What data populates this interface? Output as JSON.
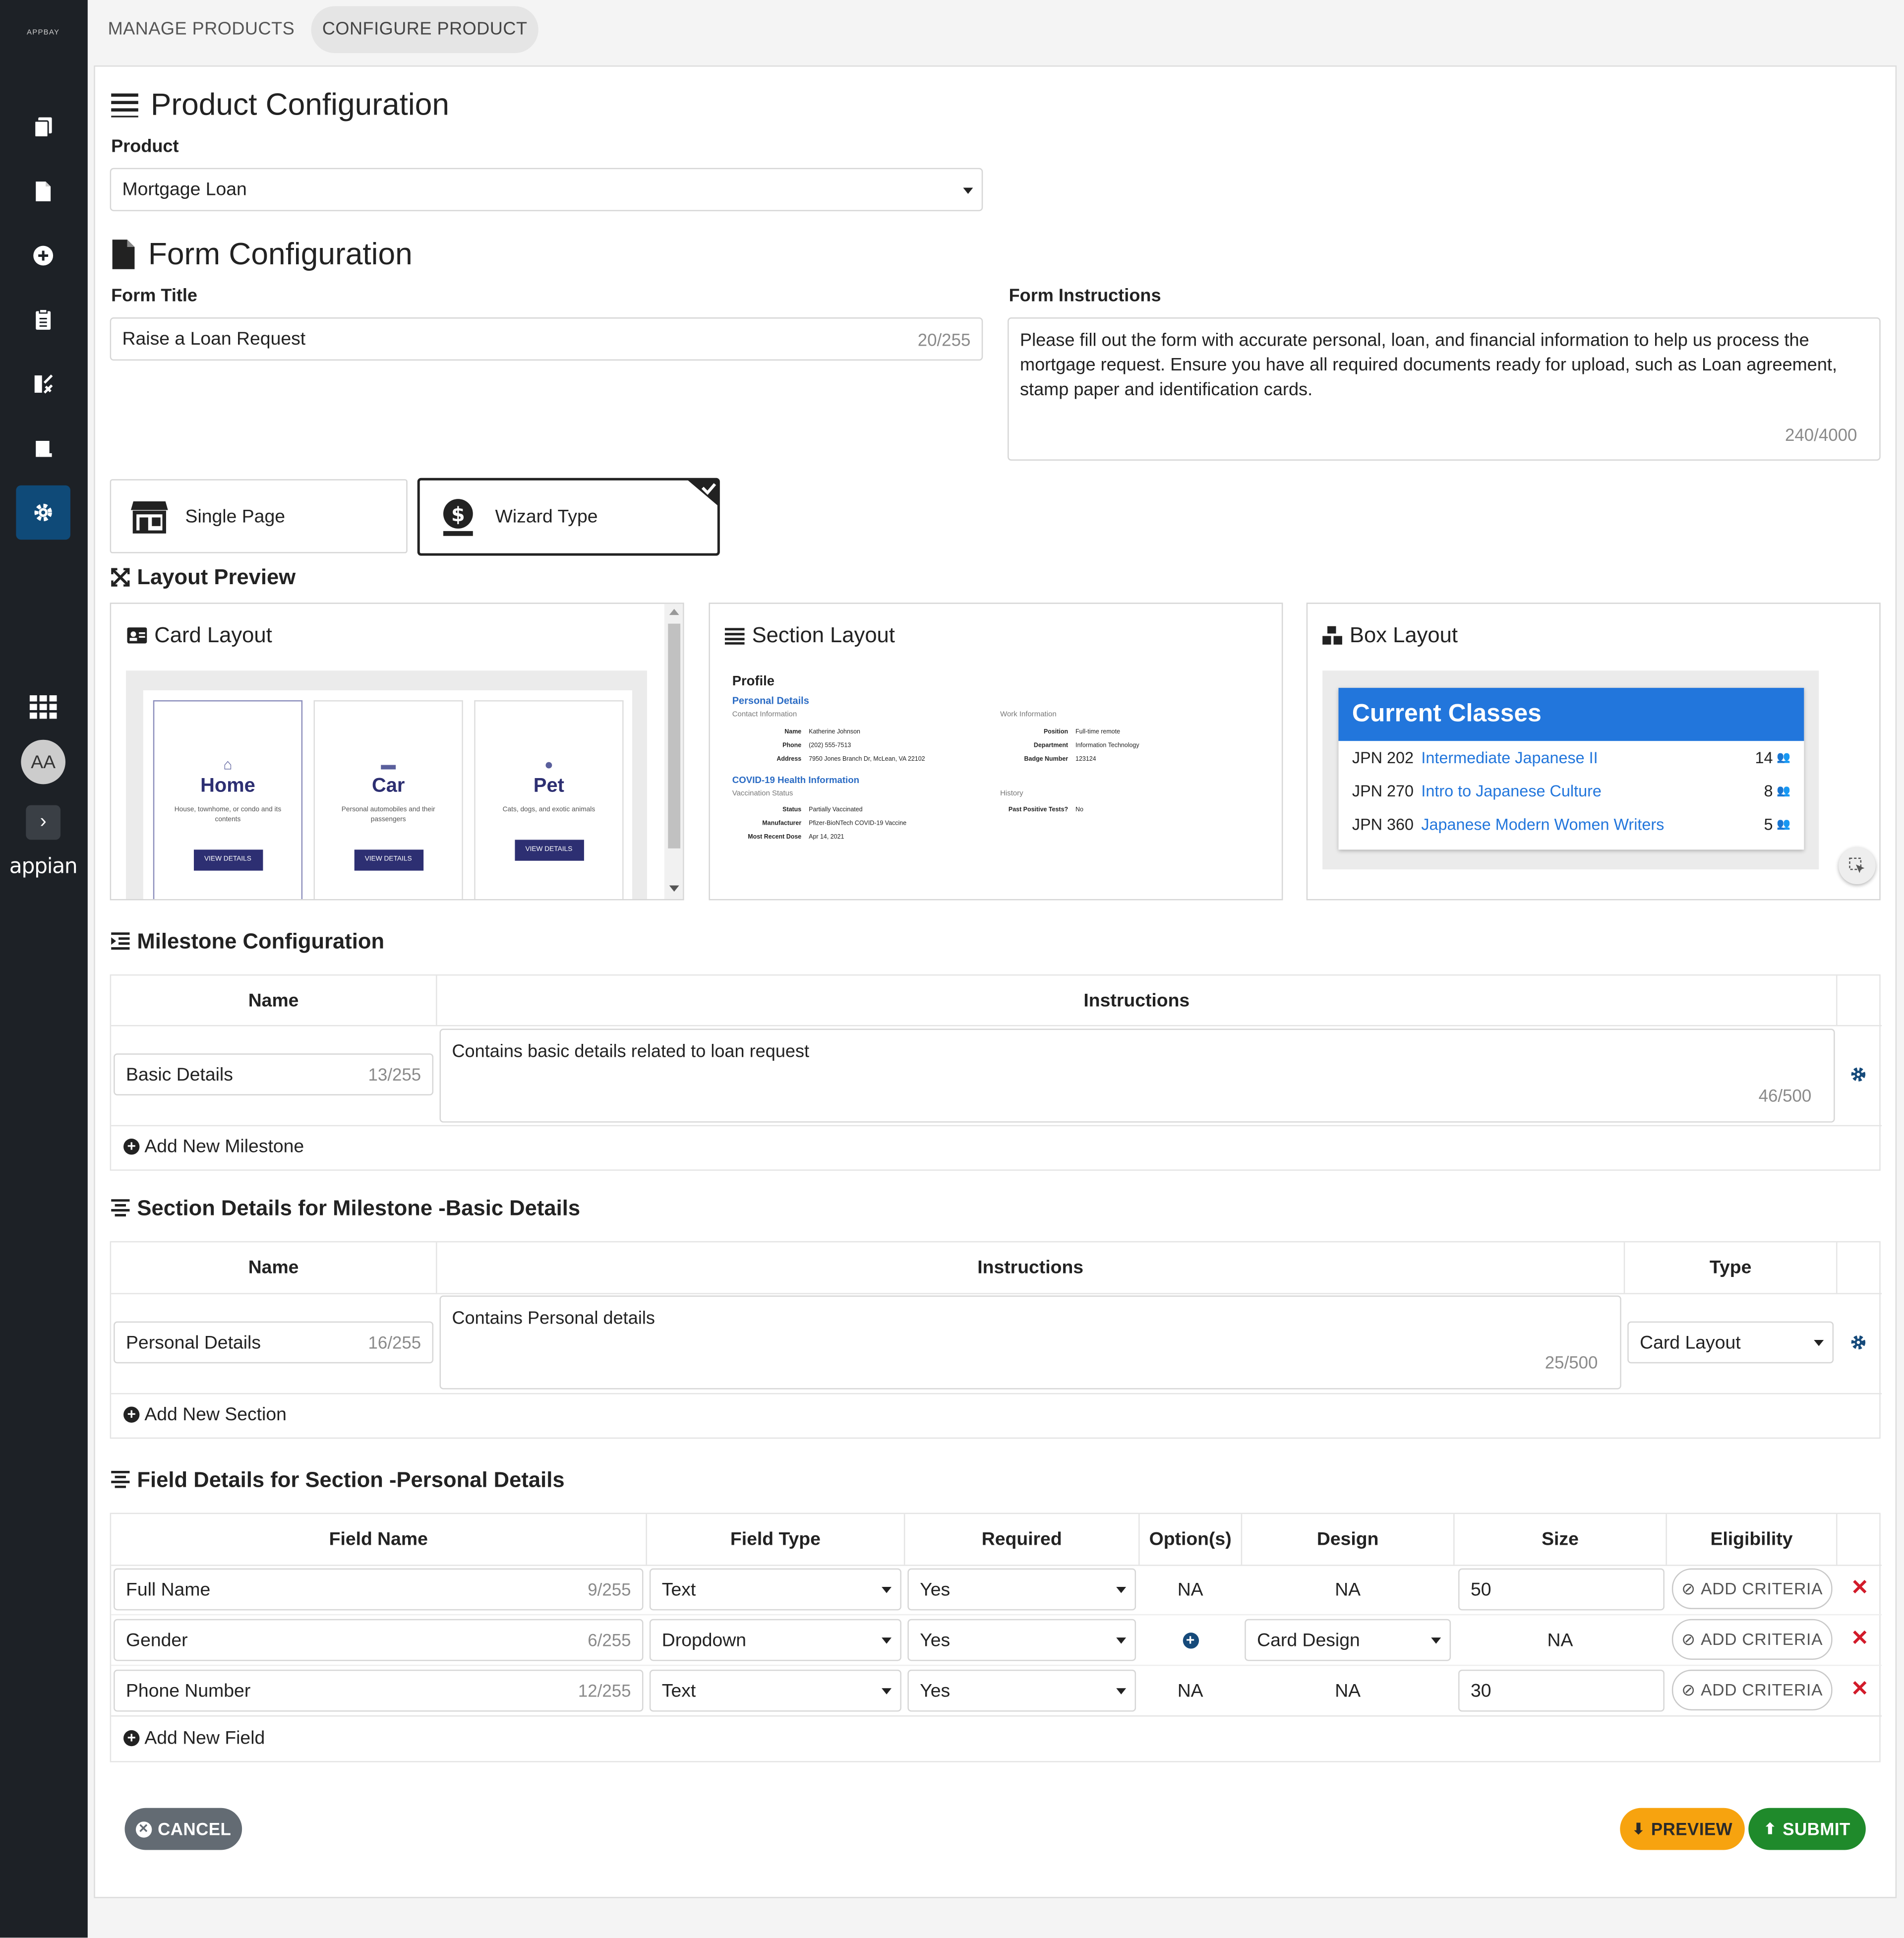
{
  "sidebar": {
    "brand": "APPBAY",
    "avatar": "AA",
    "platform": "appian"
  },
  "tabs": [
    {
      "label": "MANAGE PRODUCTS"
    },
    {
      "label": "CONFIGURE PRODUCT"
    }
  ],
  "product_config": {
    "title": "Product Configuration",
    "product_label": "Product",
    "product_value": "Mortgage Loan"
  },
  "form_config": {
    "title": "Form Configuration",
    "form_title_label": "Form Title",
    "form_title_value": "Raise a Loan Request",
    "form_title_count": "20/255",
    "instructions_label": "Form Instructions",
    "instructions_value": "Please fill out the form with accurate personal, loan, and financial information to help us process the mortgage request. Ensure you have all required documents ready for upload, such as Loan agreement, stamp paper and identification cards.",
    "instructions_count": "240/4000",
    "types": [
      {
        "label": "Single Page"
      },
      {
        "label": "Wizard Type"
      }
    ]
  },
  "layout_preview": {
    "title": "Layout Preview",
    "card": {
      "title": "Card Layout",
      "items": [
        {
          "name": "Home",
          "desc": "House, townhome, or condo and its contents",
          "btn": "VIEW DETAILS"
        },
        {
          "name": "Car",
          "desc": "Personal automobiles and their passengers",
          "btn": "VIEW DETAILS"
        },
        {
          "name": "Pet",
          "desc": "Cats, dogs, and exotic animals",
          "btn": "VIEW DETAILS"
        }
      ]
    },
    "section": {
      "title": "Section Layout",
      "profile": "Profile",
      "personal": "Personal Details",
      "contact": "Contact Information",
      "work": "Work Information",
      "rows_left": [
        [
          "Name",
          "Katherine Johnson"
        ],
        [
          "Phone",
          "(202) 555-7513"
        ],
        [
          "Address",
          "7950 Jones Branch Dr, McLean, VA 22102"
        ]
      ],
      "rows_right": [
        [
          "Position",
          "Full-time remote"
        ],
        [
          "Department",
          "Information Technology"
        ],
        [
          "Badge Number",
          "123124"
        ]
      ],
      "covid": "COVID-19 Health Information",
      "vacc": "Vaccination Status",
      "history": "History",
      "rows_left2": [
        [
          "Status",
          "Partially Vaccinated"
        ],
        [
          "Manufacturer",
          "Pfizer-BioNTech COVID-19 Vaccine"
        ],
        [
          "Most Recent Dose",
          "Apr 14, 2021"
        ]
      ],
      "rows_right2": [
        [
          "Past Positive Tests?",
          "No"
        ]
      ]
    },
    "box": {
      "title": "Box Layout",
      "header": "Current Classes",
      "rows": [
        {
          "code": "JPN 202",
          "name": "Intermediate Japanese II",
          "count": "14"
        },
        {
          "code": "JPN 270",
          "name": "Intro to Japanese Culture",
          "count": "8"
        },
        {
          "code": "JPN 360",
          "name": "Japanese Modern Women Writers",
          "count": "5"
        }
      ]
    }
  },
  "milestone": {
    "title": "Milestone Configuration",
    "col_name": "Name",
    "col_instr": "Instructions",
    "name_value": "Basic Details",
    "name_count": "13/255",
    "instr_value": "Contains basic details related to loan request",
    "instr_count": "46/500",
    "add": "Add New Milestone"
  },
  "section_details": {
    "title": "Section Details for Milestone -Basic Details",
    "col_name": "Name",
    "col_instr": "Instructions",
    "col_type": "Type",
    "name_value": "Personal Details",
    "name_count": "16/255",
    "instr_value": "Contains Personal details",
    "instr_count": "25/500",
    "type_value": "Card Layout",
    "add": "Add New Section"
  },
  "field_details": {
    "title": "Field Details for Section -Personal Details",
    "cols": [
      "Field Name",
      "Field Type",
      "Required",
      "Option(s)",
      "Design",
      "Size",
      "Eligibility"
    ],
    "rows": [
      {
        "name": "Full Name",
        "count": "9/255",
        "type": "Text",
        "required": "Yes",
        "options": "NA",
        "design": "NA",
        "size": "50",
        "crit": "ADD CRITERIA"
      },
      {
        "name": "Gender",
        "count": "6/255",
        "type": "Dropdown",
        "required": "Yes",
        "options": "",
        "design": "Card Design",
        "size": "NA",
        "crit": "ADD CRITERIA"
      },
      {
        "name": "Phone Number",
        "count": "12/255",
        "type": "Text",
        "required": "Yes",
        "options": "NA",
        "design": "NA",
        "size": "30",
        "crit": "ADD CRITERIA"
      }
    ],
    "add": "Add New Field"
  },
  "actions": {
    "cancel": "CANCEL",
    "preview": "PREVIEW",
    "submit": "SUBMIT",
    "cancel_color": "#636b73",
    "preview_color": "#f7a30f",
    "submit_color": "#1f8a2b"
  }
}
